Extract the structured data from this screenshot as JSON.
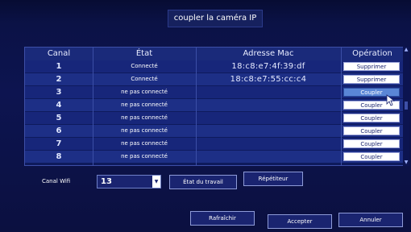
{
  "dialog": {
    "title": "coupler la caméra IP"
  },
  "table": {
    "headers": {
      "canal": "Canal",
      "etat": "État",
      "mac": "Adresse Mac",
      "operation": "Opération"
    },
    "rows": [
      {
        "canal": "1",
        "etat": "Connecté",
        "mac": "18:c8:e7:4f:39:df",
        "op": "Supprimer"
      },
      {
        "canal": "2",
        "etat": "Connecté",
        "mac": "18:c8:e7:55:cc:c4",
        "op": "Supprimer"
      },
      {
        "canal": "3",
        "etat": "ne pas connecté",
        "mac": "",
        "op": "Coupler"
      },
      {
        "canal": "4",
        "etat": "ne pas connecté",
        "mac": "",
        "op": "Coupler"
      },
      {
        "canal": "5",
        "etat": "ne pas connecté",
        "mac": "",
        "op": "Coupler"
      },
      {
        "canal": "6",
        "etat": "ne pas connecté",
        "mac": "",
        "op": "Coupler"
      },
      {
        "canal": "7",
        "etat": "ne pas connecté",
        "mac": "",
        "op": "Coupler"
      },
      {
        "canal": "8",
        "etat": "ne pas connecté",
        "mac": "",
        "op": "Coupler"
      }
    ]
  },
  "wifi": {
    "label": "Canal Wifi",
    "value": "13"
  },
  "buttons": {
    "work_status": "État du travail",
    "repeater": "Répétiteur",
    "refresh": "Rafraîchir",
    "accept": "Accepter",
    "cancel": "Annuler"
  },
  "colors": {
    "background": "#0d1450",
    "row": "#1d2f86",
    "active_button": "#5a86d6"
  }
}
